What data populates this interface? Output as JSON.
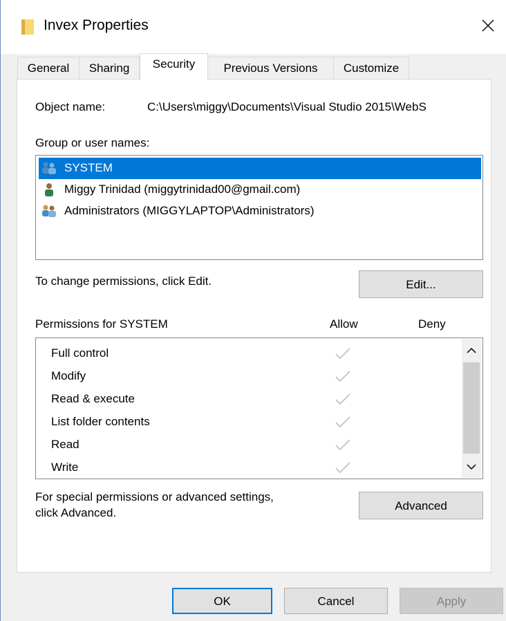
{
  "window": {
    "title": "Invex Properties",
    "close_glyph": "✕"
  },
  "tabs": [
    {
      "label": "General"
    },
    {
      "label": "Sharing"
    },
    {
      "label": "Security"
    },
    {
      "label": "Previous Versions"
    },
    {
      "label": "Customize"
    }
  ],
  "object": {
    "label": "Object name:",
    "value": "C:\\Users\\miggy\\Documents\\Visual Studio 2015\\WebS"
  },
  "groups": {
    "label": "Group or user names:",
    "items": [
      {
        "name": "SYSTEM",
        "icon": "group-users-icon",
        "selected": true
      },
      {
        "name": "Miggy Trinidad (miggytrinidad00@gmail.com)",
        "icon": "user-icon",
        "selected": false
      },
      {
        "name": "Administrators (MIGGYLAPTOP\\Administrators)",
        "icon": "group-users-icon",
        "selected": false
      }
    ]
  },
  "change_hint": "To change permissions, click Edit.",
  "edit_button": "Edit...",
  "permissions": {
    "label": "Permissions for SYSTEM",
    "allow_header": "Allow",
    "deny_header": "Deny",
    "rows": [
      {
        "name": "Full control",
        "allow": true,
        "deny": false
      },
      {
        "name": "Modify",
        "allow": true,
        "deny": false
      },
      {
        "name": "Read & execute",
        "allow": true,
        "deny": false
      },
      {
        "name": "List folder contents",
        "allow": true,
        "deny": false
      },
      {
        "name": "Read",
        "allow": true,
        "deny": false
      },
      {
        "name": "Write",
        "allow": true,
        "deny": false
      }
    ]
  },
  "advanced": {
    "hint_line1": "For special permissions or advanced settings,",
    "hint_line2": "click Advanced.",
    "button": "Advanced"
  },
  "footer": {
    "ok": "OK",
    "cancel": "Cancel",
    "apply": "Apply"
  },
  "colors": {
    "selection": "#0078d7",
    "check": "#c8c8c8",
    "dialog_bg": "#f0f0f0"
  }
}
